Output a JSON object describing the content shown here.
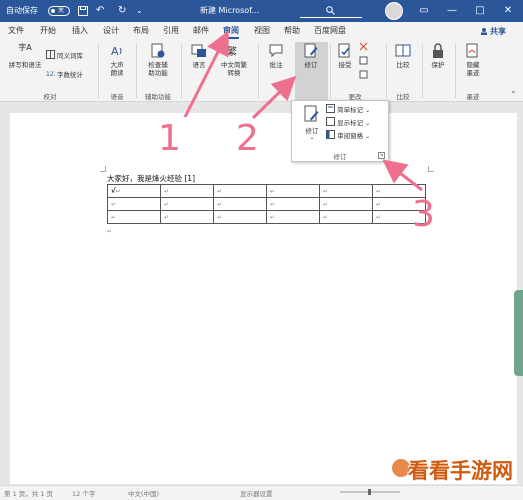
{
  "titlebar": {
    "autosave_label": "自动保存",
    "autosave_state": "关",
    "doc_title": "新建 Microsof...",
    "win_min": "—",
    "win_max": "□",
    "win_close": "✕"
  },
  "tabs": [
    "文件",
    "开始",
    "插入",
    "设计",
    "布局",
    "引用",
    "邮件",
    "审阅",
    "视图",
    "帮助",
    "百度网盘"
  ],
  "active_tab": "审阅",
  "share": "共享",
  "ribbon": {
    "proof": {
      "spell": "拼写和语法",
      "thesaurus": "同义词库",
      "wordcount": "字数统计",
      "spell_icon": "字A",
      "group": "校对"
    },
    "speech": {
      "read": "大声朗读",
      "group": "语音"
    },
    "access": {
      "check": "检查辅助功能",
      "group": "辅助功能"
    },
    "lang": {
      "lang": "语言",
      "convert": "中文简繁转换"
    },
    "comments": {
      "comment": "批注"
    },
    "tracking": {
      "track": "修订"
    },
    "changes": {
      "accept": "接受",
      "group": "更改"
    },
    "compare": {
      "compare": "比较",
      "group": "比较"
    },
    "protect": {
      "protect": "保护"
    },
    "ink": {
      "hide_ink": "隐藏墨迹",
      "group": "墨迹"
    }
  },
  "popup": {
    "track": "修订",
    "simple_markup": "简单标记",
    "show_markup": "显示标记",
    "review_pane": "审阅窗格",
    "group": "修订"
  },
  "document": {
    "line": "大家好，我是烽火经验 [1]",
    "checkmark": "√",
    "cell_mark": "↵"
  },
  "annotations": [
    "1",
    "2",
    "3"
  ],
  "status": {
    "page": "第 1 页，共 1 页",
    "words": "12 个字",
    "lang": "中文(中国)",
    "display": "显示器设置",
    "zoom": "100%"
  },
  "watermark": "看看手游网",
  "colors": {
    "brand": "#2b579a",
    "arrow": "#ef6f8f",
    "handle": "#6fa58e",
    "watermark": "#d05a0e"
  }
}
